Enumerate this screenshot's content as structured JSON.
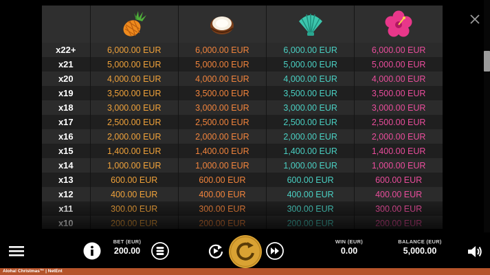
{
  "paytable": {
    "symbols": [
      {
        "name": "pineapple-icon"
      },
      {
        "name": "coconut-icon"
      },
      {
        "name": "shell-icon"
      },
      {
        "name": "hibiscus-icon"
      }
    ],
    "rows": [
      {
        "mult": "x22+",
        "values": [
          "6,000.00 EUR",
          "6,000.00 EUR",
          "6,000.00 EUR",
          "6,000.00 EUR"
        ]
      },
      {
        "mult": "x21",
        "values": [
          "5,000.00 EUR",
          "5,000.00 EUR",
          "5,000.00 EUR",
          "5,000.00 EUR"
        ]
      },
      {
        "mult": "x20",
        "values": [
          "4,000.00 EUR",
          "4,000.00 EUR",
          "4,000.00 EUR",
          "4,000.00 EUR"
        ]
      },
      {
        "mult": "x19",
        "values": [
          "3,500.00 EUR",
          "3,500.00 EUR",
          "3,500.00 EUR",
          "3,500.00 EUR"
        ]
      },
      {
        "mult": "x18",
        "values": [
          "3,000.00 EUR",
          "3,000.00 EUR",
          "3,000.00 EUR",
          "3,000.00 EUR"
        ]
      },
      {
        "mult": "x17",
        "values": [
          "2,500.00 EUR",
          "2,500.00 EUR",
          "2,500.00 EUR",
          "2,500.00 EUR"
        ]
      },
      {
        "mult": "x16",
        "values": [
          "2,000.00 EUR",
          "2,000.00 EUR",
          "2,000.00 EUR",
          "2,000.00 EUR"
        ]
      },
      {
        "mult": "x15",
        "values": [
          "1,400.00 EUR",
          "1,400.00 EUR",
          "1,400.00 EUR",
          "1,400.00 EUR"
        ]
      },
      {
        "mult": "x14",
        "values": [
          "1,000.00 EUR",
          "1,000.00 EUR",
          "1,000.00 EUR",
          "1,000.00 EUR"
        ]
      },
      {
        "mult": "x13",
        "values": [
          "600.00 EUR",
          "600.00 EUR",
          "600.00 EUR",
          "600.00 EUR"
        ]
      },
      {
        "mult": "x12",
        "values": [
          "400.00 EUR",
          "400.00 EUR",
          "400.00 EUR",
          "400.00 EUR"
        ]
      },
      {
        "mult": "x11",
        "values": [
          "300.00 EUR",
          "300.00 EUR",
          "300.00 EUR",
          "300.00 EUR"
        ]
      },
      {
        "mult": "x10",
        "values": [
          "200.00 EUR",
          "200.00 EUR",
          "200.00 EUR",
          "200.00 EUR"
        ]
      }
    ],
    "colors": {
      "pineapple": "#f0a23a",
      "coconut": "#f2843c",
      "shell": "#4ad1c4",
      "hibiscus": "#ea4d9c"
    }
  },
  "controls": {
    "bet_label": "BET (EUR)",
    "bet_value": "200.00",
    "win_label": "WIN (EUR)",
    "win_value": "0.00",
    "balance_label": "BALANCE (EUR)",
    "balance_value": "5,000.00",
    "icons": [
      "menu-icon",
      "info-icon",
      "coin-stack-icon",
      "autoplay-icon",
      "spin-icon",
      "fast-forward-icon",
      "sound-icon",
      "close-icon"
    ],
    "accent_color": "#d9a233"
  },
  "footer": {
    "title": "Aloha! Christmas™ | NetEnt"
  }
}
